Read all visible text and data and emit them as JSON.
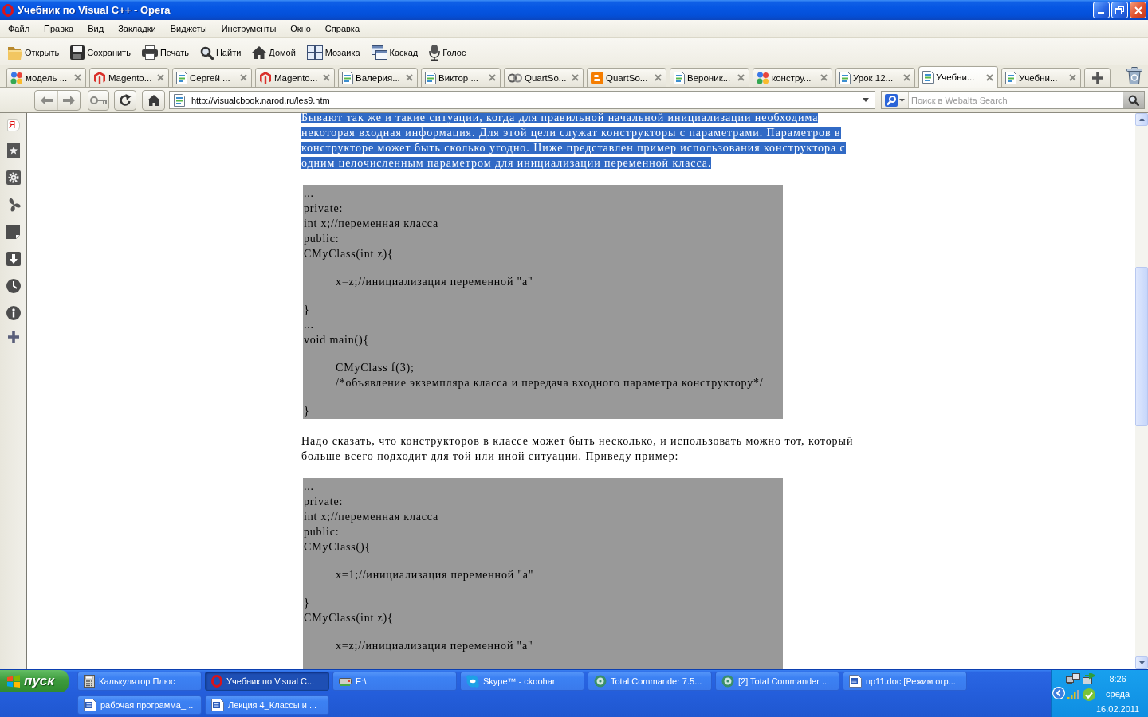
{
  "window": {
    "title": "Учебник по Visual C++ - Opera"
  },
  "menu_bar": [
    "Файл",
    "Правка",
    "Вид",
    "Закладки",
    "Виджеты",
    "Инструменты",
    "Окно",
    "Справка"
  ],
  "toolbar": [
    "Открыть",
    "Сохранить",
    "Печать",
    "Найти",
    "Домой",
    "Мозаика",
    "Каскад",
    "Голос"
  ],
  "tabs": [
    {
      "title": "модель ...",
      "selected": false
    },
    {
      "title": "Magento...",
      "selected": false
    },
    {
      "title": "Сергей ...",
      "selected": false
    },
    {
      "title": "Magento...",
      "selected": false
    },
    {
      "title": "Валерия...",
      "selected": false
    },
    {
      "title": "Виктор ...",
      "selected": false
    },
    {
      "title": "QuartSo...",
      "selected": false
    },
    {
      "title": "QuartSo...",
      "selected": false
    },
    {
      "title": "Вероник...",
      "selected": false
    },
    {
      "title": "констру...",
      "selected": false
    },
    {
      "title": "Урок 12...",
      "selected": false
    },
    {
      "title": "Учебни...",
      "selected": true
    },
    {
      "title": "Учебни...",
      "selected": false
    }
  ],
  "address_bar": {
    "url": "http://visualcbook.narod.ru/les9.htm"
  },
  "search_field": {
    "placeholder": "Поиск в Webalta Search"
  },
  "side_panel": {
    "first_button": "Я"
  },
  "page": {
    "blocks": [
      {
        "kind": "paragraph",
        "highlighted": true,
        "text": "Бывают так же и такие ситуации, когда для правильной начальной инициализации необходима некоторая входная информация. Для этой цели служат конструкторы с параметрами. Параметров в конструкторе может быть сколько угодно. Ниже представлен пример использования конструктора с одним целочисленным параметром для инициализации переменной класса."
      },
      {
        "kind": "code",
        "groups": [
          {
            "indented": false,
            "lines": [
              "...",
              "private:",
              "int x;//переменная класса",
              "public:",
              "CMyClass(int z){"
            ]
          },
          {
            "indented": true,
            "lines": [
              "x=z;//инициализация переменной \"a\""
            ]
          },
          {
            "indented": false,
            "lines": [
              "}",
              "...",
              "void main(){"
            ]
          },
          {
            "indented": true,
            "lines": [
              "CMyClass f(3);",
              "/*объявление экземпляра класса и передача входного параметра конструктору*/"
            ]
          },
          {
            "indented": false,
            "lines": [
              "}"
            ]
          }
        ]
      },
      {
        "kind": "paragraph",
        "highlighted": false,
        "text": "Надо сказать, что конструкторов в классе может быть несколько, и использовать можно тот, который больше всего подходит для той или иной ситуации. Приведу пример:"
      },
      {
        "kind": "code",
        "groups": [
          {
            "indented": false,
            "lines": [
              "...",
              "private:",
              "int x;//переменная класса",
              "public:",
              "CMyClass(){"
            ]
          },
          {
            "indented": true,
            "lines": [
              "x=1;//инициализация переменной \"a\""
            ]
          },
          {
            "indented": false,
            "lines": [
              "}",
              "CMyClass(int z){"
            ]
          },
          {
            "indented": true,
            "lines": [
              "x=z;//инициализация переменной \"a\""
            ]
          }
        ]
      }
    ]
  },
  "taskbar": {
    "start_button": "пуск",
    "rows": [
      [
        {
          "label": "Калькулятор Плюс",
          "selected": false
        },
        {
          "label": "Учебник по Visual C...",
          "selected": true
        },
        {
          "label": "E:\\",
          "selected": false
        },
        {
          "label": "Skype™ - ckoohar",
          "selected": false
        },
        {
          "label": "Total Commander 7.5...",
          "selected": false
        },
        {
          "label": "[2] Total Commander ...",
          "selected": false
        },
        {
          "label": "пр11.doc [Режим огр...",
          "selected": false
        }
      ],
      [
        {
          "label": "рабочая программа_...",
          "selected": false
        },
        {
          "label": "Лекция 4_Классы и ...",
          "selected": false
        }
      ]
    ],
    "tray": {
      "time": "8:26",
      "day": "среда",
      "date": "16.02.2011"
    }
  }
}
